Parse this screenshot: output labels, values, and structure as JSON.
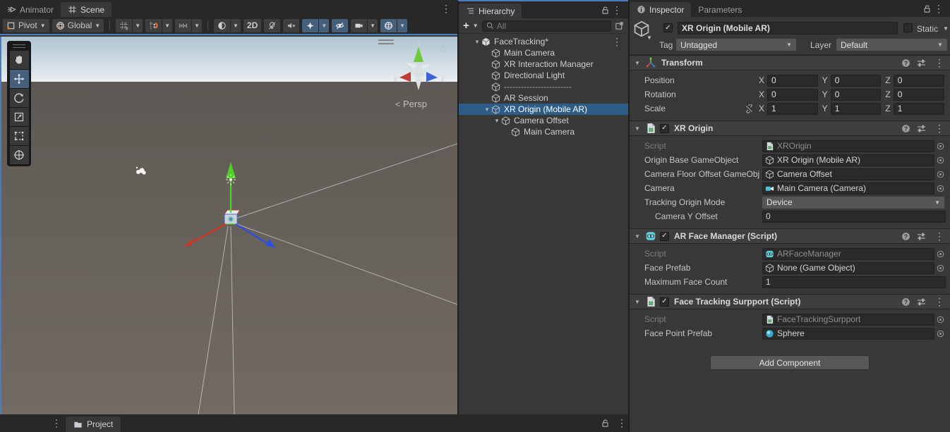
{
  "scene": {
    "tabs": {
      "animator": "Animator",
      "scene": "Scene"
    },
    "toolbar": {
      "pivot": "Pivot",
      "global": "Global",
      "two_d": "2D"
    },
    "viewport": {
      "persp": "Persp",
      "axis_x": "x",
      "axis_y": "y",
      "axis_z": "z"
    }
  },
  "hierarchy": {
    "title": "Hierarchy",
    "create_button": "+",
    "search_placeholder": "All",
    "items": [
      {
        "label": "FaceTracking*"
      },
      {
        "label": "Main Camera"
      },
      {
        "label": "XR Interaction Manager"
      },
      {
        "label": "Directional Light"
      },
      {
        "label": "------------------------"
      },
      {
        "label": "AR Session"
      },
      {
        "label": "XR Origin (Mobile AR)"
      },
      {
        "label": "Camera Offset"
      },
      {
        "label": "Main Camera"
      }
    ]
  },
  "inspector": {
    "tabs": {
      "inspector": "Inspector",
      "parameters": "Parameters"
    },
    "header": {
      "name": "XR Origin (Mobile AR)",
      "static_label": "Static",
      "tag_label": "Tag",
      "tag_value": "Untagged",
      "layer_label": "Layer",
      "layer_value": "Default"
    },
    "transform": {
      "title": "Transform",
      "axes": {
        "x": "X",
        "y": "Y",
        "z": "Z"
      },
      "position": {
        "label": "Position",
        "x": "0",
        "y": "0",
        "z": "0"
      },
      "rotation": {
        "label": "Rotation",
        "x": "0",
        "y": "0",
        "z": "0"
      },
      "scale": {
        "label": "Scale",
        "x": "1",
        "y": "1",
        "z": "1"
      }
    },
    "xr_origin": {
      "title": "XR Origin",
      "script_label": "Script",
      "script_value": "XROrigin",
      "origin_base_label": "Origin Base GameObject",
      "origin_base_value": "XR Origin (Mobile AR)",
      "camera_floor_label": "Camera Floor Offset GameObj",
      "camera_floor_value": "Camera Offset",
      "camera_label": "Camera",
      "camera_value": "Main Camera (Camera)",
      "tracking_label": "Tracking Origin Mode",
      "tracking_value": "Device",
      "y_offset_label": "Camera Y Offset",
      "y_offset_value": "0"
    },
    "ar_face_manager": {
      "title": "AR Face Manager (Script)",
      "script_label": "Script",
      "script_value": "ARFaceManager",
      "face_prefab_label": "Face Prefab",
      "face_prefab_value": "None (Game Object)",
      "max_face_label": "Maximum Face Count",
      "max_face_value": "1"
    },
    "face_tracking": {
      "title": "Face Tracking Surpport (Script)",
      "script_label": "Script",
      "script_value": "FaceTrackingSurpport",
      "face_point_label": "Face Point Prefab",
      "face_point_value": "Sphere"
    },
    "add_component": "Add Component"
  },
  "project": {
    "title": "Project"
  },
  "colors": {
    "selection_blue": "#2d5c87",
    "toggle_active_blue": "#46607c",
    "focus_outline_blue": "#4a7dbd",
    "axis_red": "#d63226",
    "axis_green": "#4fd32c",
    "axis_blue": "#2c50e0",
    "panel_bg": "#383838",
    "tabbar_bg": "#282828",
    "field_bg": "#2a2a2a"
  }
}
